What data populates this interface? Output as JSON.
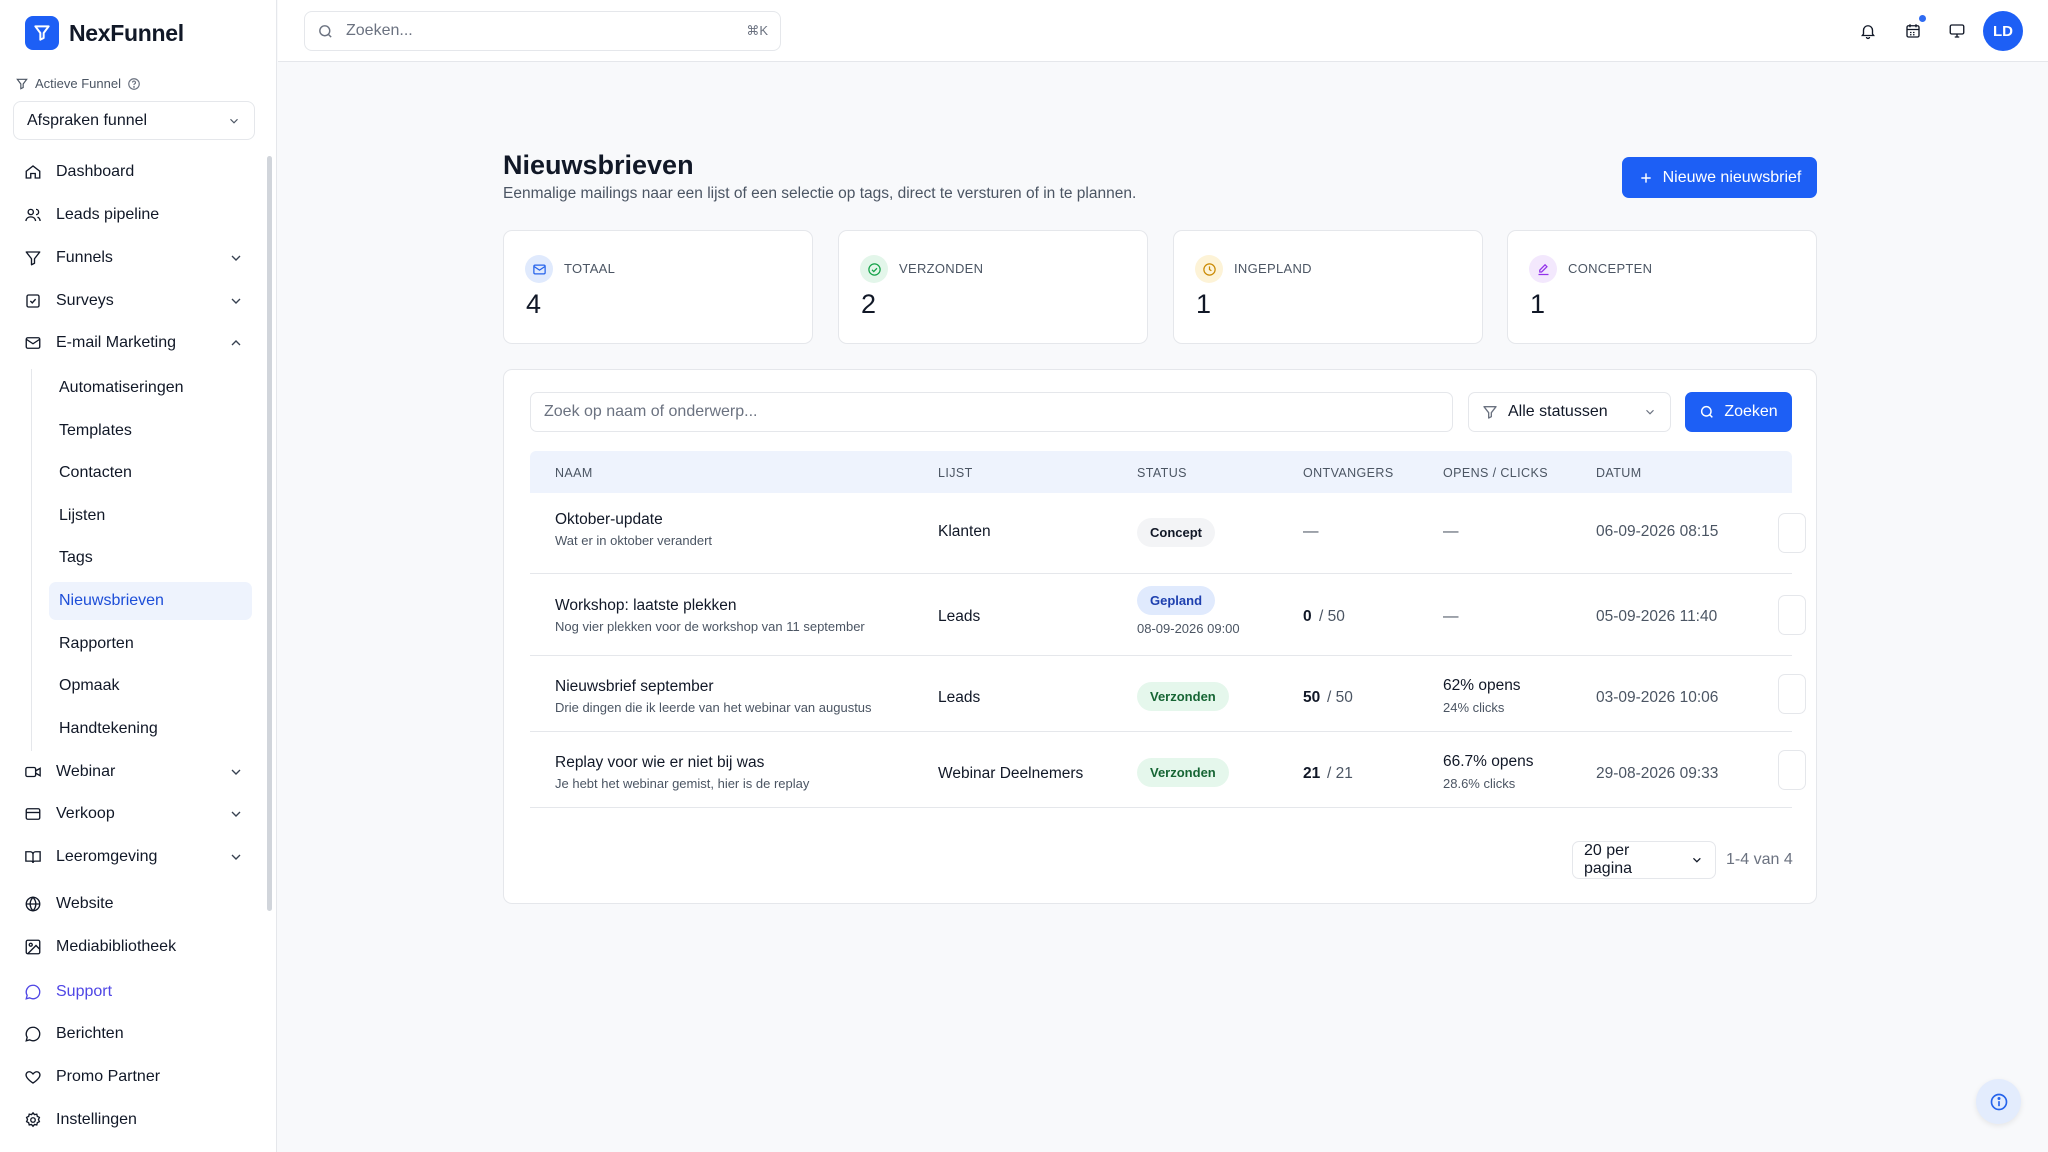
{
  "app": {
    "name": "NexFunnel"
  },
  "sidebar": {
    "active_funnel_label": "Actieve Funnel",
    "funnel_value": "Afspraken funnel",
    "items": [
      {
        "label": "Dashboard",
        "icon": "home-icon"
      },
      {
        "label": "Leads pipeline",
        "icon": "users-icon"
      },
      {
        "label": "Funnels",
        "icon": "filter-icon"
      },
      {
        "label": "Surveys",
        "icon": "checkbox-icon"
      },
      {
        "label": "E-mail Marketing",
        "icon": "mail-icon"
      }
    ],
    "email_sub": [
      "Automatiseringen",
      "Templates",
      "Contacten",
      "Lijsten",
      "Tags",
      "Nieuwsbrieven",
      "Rapporten",
      "Opmaak",
      "Handtekening"
    ],
    "items2": [
      {
        "label": "Webinar",
        "icon": "video-icon"
      },
      {
        "label": "Verkoop",
        "icon": "credit-card-icon"
      },
      {
        "label": "Leeromgeving",
        "icon": "book-icon"
      },
      {
        "label": "Website",
        "icon": "globe-icon"
      },
      {
        "label": "Mediabibliotheek",
        "icon": "image-icon"
      },
      {
        "label": "Support",
        "icon": "chat-icon"
      },
      {
        "label": "Berichten",
        "icon": "message-icon"
      },
      {
        "label": "Promo Partner",
        "icon": "heart-icon"
      },
      {
        "label": "Instellingen",
        "icon": "gear-icon"
      }
    ]
  },
  "topbar": {
    "search_placeholder": "Zoeken...",
    "search_shortcut": "⌘K",
    "avatar_initials": "LD"
  },
  "page": {
    "title": "Nieuwsbrieven",
    "subtitle": "Eenmalige mailings naar een lijst of een selectie op tags, direct te versturen of in te plannen.",
    "new_button": "Nieuwe nieuwsbrief"
  },
  "stats": [
    {
      "label": "TOTAAL",
      "value": "4",
      "color": "#2563eb",
      "bg": "#e0eafd"
    },
    {
      "label": "VERZONDEN",
      "value": "2",
      "color": "#16a34a",
      "bg": "#e3f6ea"
    },
    {
      "label": "INGEPLAND",
      "value": "1",
      "color": "#ca8a04",
      "bg": "#fdf3d7"
    },
    {
      "label": "CONCEPTEN",
      "value": "1",
      "color": "#9333ea",
      "bg": "#f3e8fd"
    }
  ],
  "table": {
    "search_placeholder": "Zoek op naam of onderwerp...",
    "filter_value": "Alle statussen",
    "search_button": "Zoeken",
    "headers": [
      "NAAM",
      "LIJST",
      "STATUS",
      "ONTVANGERS",
      "OPENS / CLICKS",
      "DATUM"
    ],
    "rows": [
      {
        "name": "Oktober-update",
        "desc": "Wat er in oktober verandert",
        "list": "Klanten",
        "status": "Concept",
        "status_type": "concept",
        "status_note": "",
        "recipients_sent": "—",
        "recipients_total": "",
        "opens": "—",
        "clicks": "",
        "date": "06-09-2026 08:15"
      },
      {
        "name": "Workshop: laatste plekken",
        "desc": "Nog vier plekken voor de workshop van 11 september",
        "list": "Leads",
        "status": "Gepland",
        "status_type": "gepland",
        "status_note": "08-09-2026 09:00",
        "recipients_sent": "0",
        "recipients_total": "/ 50",
        "opens": "—",
        "clicks": "",
        "date": "05-09-2026 11:40"
      },
      {
        "name": "Nieuwsbrief september",
        "desc": "Drie dingen die ik leerde van het webinar van augustus",
        "list": "Leads",
        "status": "Verzonden",
        "status_type": "verzonden",
        "status_note": "",
        "recipients_sent": "50",
        "recipients_total": "/ 50",
        "opens": "62% opens",
        "clicks": "24% clicks",
        "date": "03-09-2026 10:06"
      },
      {
        "name": "Replay voor wie er niet bij was",
        "desc": "Je hebt het webinar gemist, hier is de replay",
        "list": "Webinar Deelnemers",
        "status": "Verzonden",
        "status_type": "verzonden",
        "status_note": "",
        "recipients_sent": "21",
        "recipients_total": "/ 21",
        "opens": "66.7% opens",
        "clicks": "28.6% clicks",
        "date": "29-08-2026 09:33"
      }
    ],
    "per_page": "20 per pagina",
    "range": "1-4 van 4"
  },
  "colors": {
    "accent": "#1d5ff5",
    "active_bg": "#eef3fd"
  }
}
